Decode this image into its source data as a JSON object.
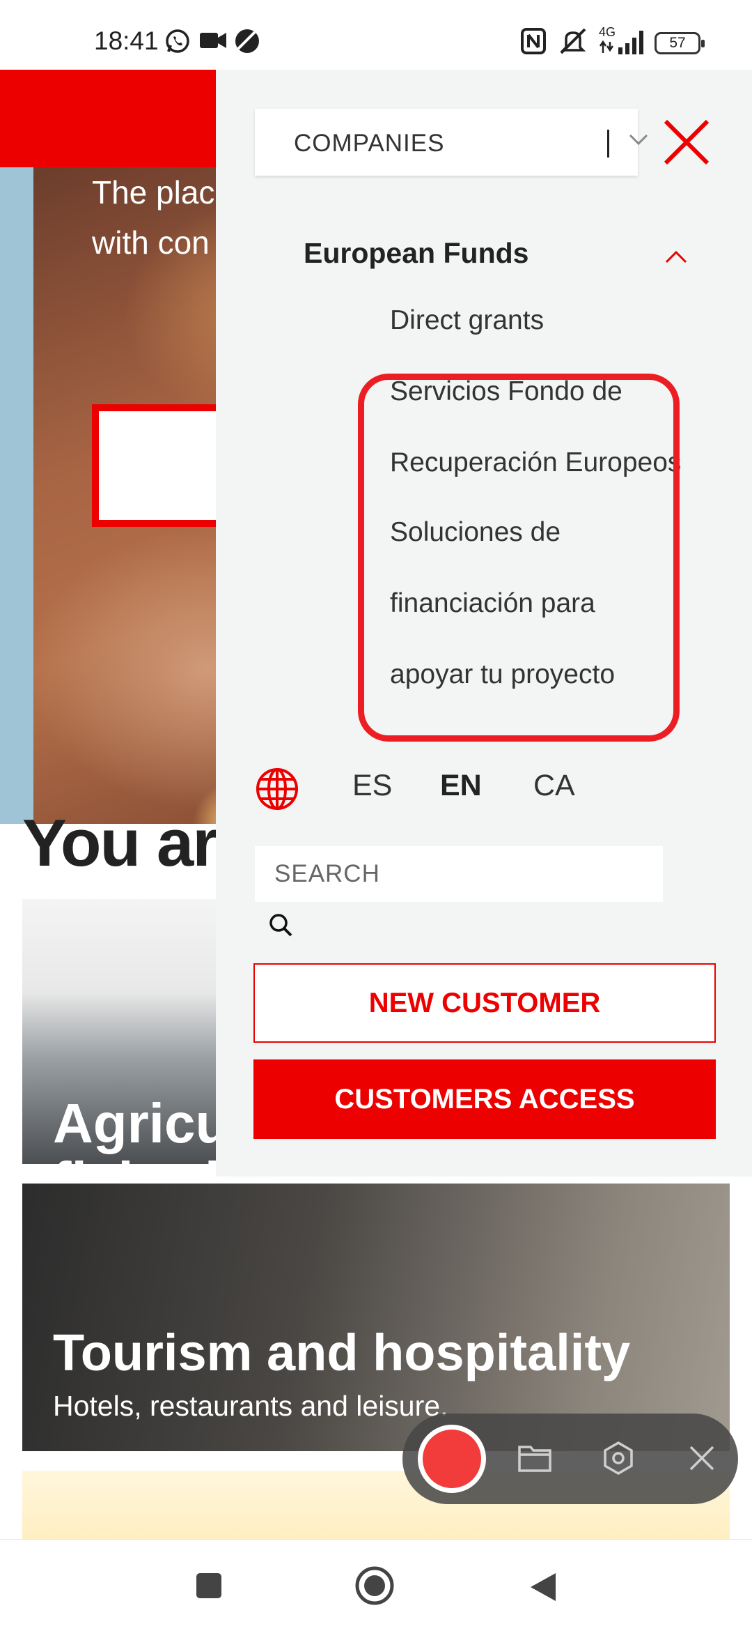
{
  "status_bar": {
    "time": "18:41",
    "icons": [
      "whatsapp-icon",
      "video-camera-icon",
      "vpn-icon",
      "nfc-icon",
      "vibrate-mute-icon",
      "signal-4g-icon"
    ],
    "network_label": "4G",
    "battery": "57"
  },
  "background_page": {
    "hero_text": "The place\nwith con",
    "heading": "You are",
    "cards": [
      {
        "title": "Agricul\nfisherie",
        "subtitle": ""
      },
      {
        "title": "Tourism and hospitality",
        "subtitle": "Hotels, restaurants and leisure."
      }
    ]
  },
  "menu": {
    "segment_select": "COMPANIES",
    "section": {
      "title": "European Funds",
      "items": [
        "Direct grants",
        "Servicios Fondo de",
        "Recuperación Europeos",
        "Soluciones de",
        "financiación para",
        "apoyar tu proyecto"
      ]
    },
    "languages": [
      {
        "code": "ES",
        "active": false
      },
      {
        "code": "EN",
        "active": true
      },
      {
        "code": "CA",
        "active": false
      }
    ],
    "search_placeholder": "SEARCH",
    "new_customer_label": "NEW CUSTOMER",
    "customers_access_label": "CUSTOMERS ACCESS"
  },
  "recorder_toolbar": {
    "icons": [
      "record-icon",
      "folder-icon",
      "settings-hex-icon",
      "close-icon"
    ]
  },
  "nav_bar": {
    "icons": [
      "recents-square-icon",
      "home-circle-icon",
      "back-triangle-icon"
    ]
  },
  "colors": {
    "brand_red": "#ec0000",
    "highlight_red": "#ec1e24",
    "menu_background": "#f3f4f4"
  }
}
